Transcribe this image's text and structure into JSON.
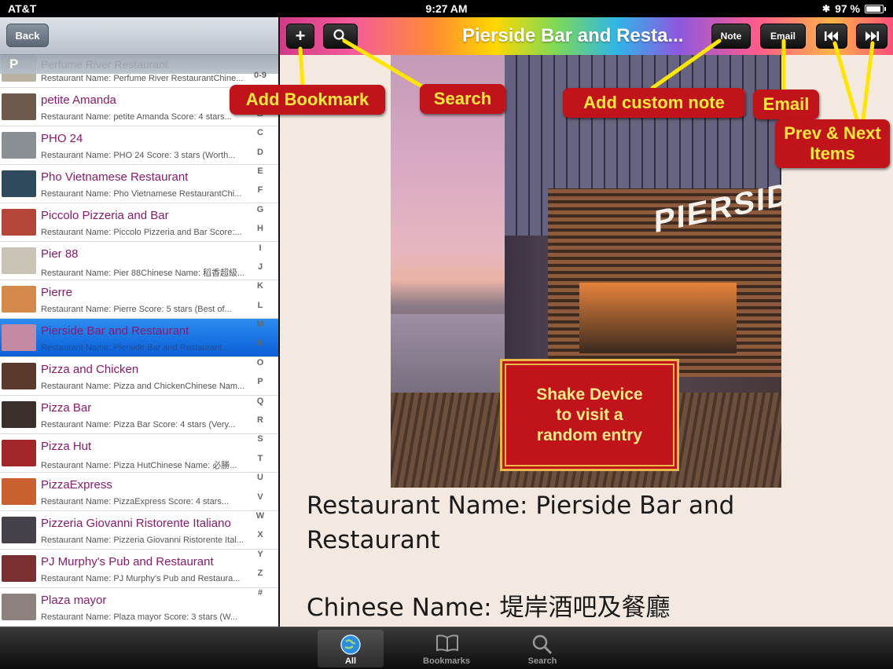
{
  "status_bar": {
    "carrier": "AT&T",
    "time": "9:27 AM",
    "battery_text": "97 %",
    "battery_level": 0.97
  },
  "nav": {
    "back_label": "Back"
  },
  "list": {
    "section_letter": "P",
    "partial_title": "Perfume River Restaurant",
    "partial_sub": "Restaurant Name: Perfume River RestaurantChine...",
    "rows": [
      {
        "title": "petite Amanda",
        "sub": "Restaurant Name: petite Amanda  Score: 4 stars...",
        "thumb": "#6d5a4a"
      },
      {
        "title": "PHO 24",
        "sub": "Restaurant Name: PHO 24  Score: 3 stars (Worth...",
        "thumb": "#8a8f96"
      },
      {
        "title": "Pho Vietnamese Restaurant",
        "sub": "Restaurant Name: Pho Vietnamese RestaurantChi...",
        "thumb": "#2f4a5c"
      },
      {
        "title": "Piccolo Pizzeria and Bar",
        "sub": "Restaurant Name: Piccolo Pizzeria and Bar  Score:...",
        "thumb": "#b5473a"
      },
      {
        "title": "Pier 88",
        "sub": "Restaurant Name: Pier 88Chinese Name: 稻香超級...",
        "thumb": "#c8c3b5"
      },
      {
        "title": "Pierre",
        "sub": "Restaurant Name: Pierre  Score: 5 stars (Best of...",
        "thumb": "#d38a4a"
      },
      {
        "title": "Pierside Bar and Restaurant",
        "sub": "Restaurant Name: Pierside Bar and Restaurant...",
        "thumb": "#c48aa4"
      },
      {
        "title": "Pizza and Chicken",
        "sub": "Restaurant Name: Pizza and ChickenChinese Nam...",
        "thumb": "#5a3a2a"
      },
      {
        "title": "Pizza Bar",
        "sub": "Restaurant Name: Pizza Bar  Score: 4 stars (Very...",
        "thumb": "#3a2f2a"
      },
      {
        "title": "Pizza Hut",
        "sub": "Restaurant Name: Pizza HutChinese Name: 必勝...",
        "thumb": "#a1262a"
      },
      {
        "title": "PizzaExpress",
        "sub": "Restaurant Name: PizzaExpress    Score: 4 stars...",
        "thumb": "#c9602f"
      },
      {
        "title": "Pizzeria Giovanni Ristorente Italiano",
        "sub": "Restaurant Name: Pizzeria Giovanni Ristorente Ital...",
        "thumb": "#46404a"
      },
      {
        "title": "PJ Murphy's Pub and Restaurant",
        "sub": "Restaurant Name: PJ Murphy's Pub and Restaura...",
        "thumb": "#7a2f30"
      },
      {
        "title": "Plaza mayor",
        "sub": "Restaurant Name: Plaza mayor  Score: 3 stars (W...",
        "thumb": "#8d8280"
      }
    ],
    "selected_index": 6,
    "index_letters": [
      "0-9",
      "A",
      "B",
      "C",
      "D",
      "E",
      "F",
      "G",
      "H",
      "I",
      "J",
      "K",
      "L",
      "M",
      "N",
      "O",
      "P",
      "Q",
      "R",
      "S",
      "T",
      "U",
      "V",
      "W",
      "X",
      "Y",
      "Z",
      "#"
    ]
  },
  "toolbar": {
    "title": "Pierside Bar and Resta...",
    "add_label": "+",
    "note_label": "Note",
    "email_label": "Email"
  },
  "photo": {
    "sign_text": "PIERSIDE"
  },
  "shake_banner": {
    "line1": "Shake Device",
    "line2": "to visit a",
    "line3": "random entry"
  },
  "detail": {
    "name_line": "Restaurant Name: Pierside Bar and Restaurant",
    "chinese_line": "Chinese Name: 堤岸酒吧及餐廳"
  },
  "callouts": {
    "add_bookmark": "Add Bookmark",
    "search": "Search",
    "add_note": "Add custom note",
    "email": "Email",
    "prev_next_1": "Prev & Next",
    "prev_next_2": "Items"
  },
  "tabs": [
    {
      "label": "All",
      "icon": "globe-icon",
      "active": true
    },
    {
      "label": "Bookmarks",
      "icon": "book-icon",
      "active": false
    },
    {
      "label": "Search",
      "icon": "search-icon",
      "active": false
    }
  ],
  "colors": {
    "accent_red": "#c1141a",
    "callout_text": "#ffea3b",
    "title_purple": "#8b1a6e",
    "selected_blue": "#0b5fd7"
  }
}
